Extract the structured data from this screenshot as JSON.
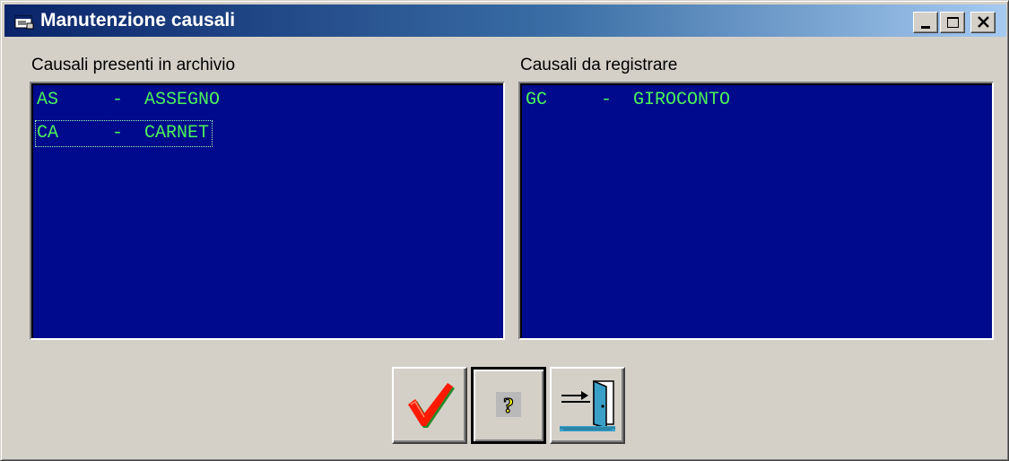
{
  "window": {
    "title": "Manutenzione causali",
    "controls": [
      "minimize-icon",
      "maximize-icon",
      "close-icon"
    ]
  },
  "left_panel": {
    "label": "Causali presenti in archivio",
    "items": [
      {
        "text": "AS     -  ASSEGNO",
        "focused": false
      },
      {
        "text": "CA     -  CARNET",
        "focused": true
      }
    ]
  },
  "right_panel": {
    "label": "Causali da registrare",
    "items": [
      {
        "text": "GC     -  GIROCONTO",
        "focused": false
      }
    ]
  },
  "buttons": [
    {
      "name": "confirm",
      "icon": "checkmark-icon"
    },
    {
      "name": "help",
      "icon": "question-mark-icon"
    },
    {
      "name": "exit",
      "icon": "exit-door-icon"
    }
  ],
  "colors": {
    "listbox_background": "#000a8c",
    "list_text": "#4cf25a",
    "window_face": "#d4d0c8",
    "titlebar_start": "#0a246a",
    "titlebar_end": "#a6caf0"
  }
}
